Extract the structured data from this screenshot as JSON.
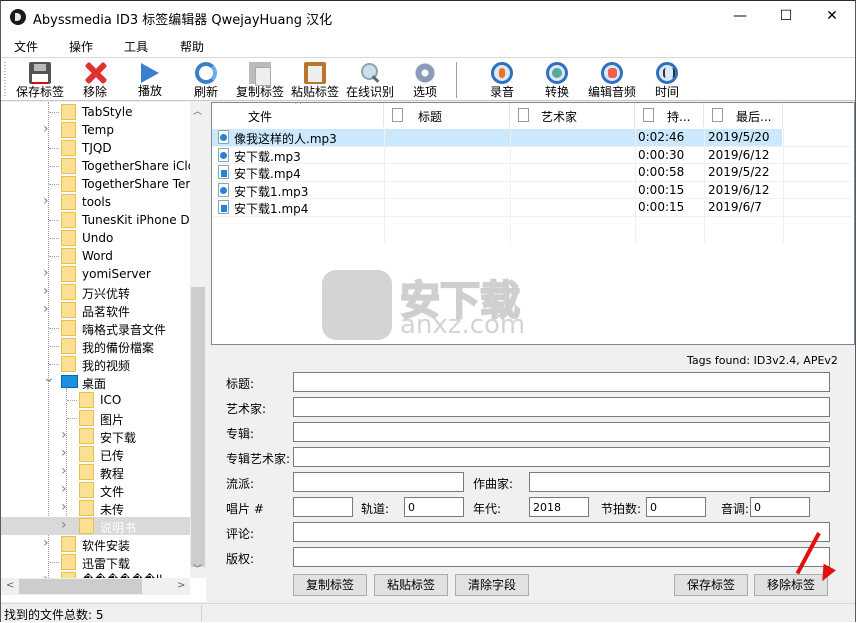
{
  "window": {
    "title": "Abyssmedia ID3 标签编辑器 QwejayHuang 汉化",
    "controls": {
      "minimize": "—",
      "maximize": "☐",
      "close": "✕"
    }
  },
  "menu": [
    "文件",
    "操作",
    "工具",
    "帮助"
  ],
  "toolbar": [
    {
      "label": "保存标签",
      "icon": "save-icon"
    },
    {
      "label": "移除",
      "icon": "remove-icon"
    },
    {
      "label": "播放",
      "icon": "play-icon"
    },
    {
      "label": "刷新",
      "icon": "refresh-icon"
    },
    {
      "label": "复制标签",
      "icon": "copy-icon"
    },
    {
      "label": "粘贴标签",
      "icon": "paste-icon"
    },
    {
      "label": "在线识别",
      "icon": "search-icon"
    },
    {
      "label": "选项",
      "icon": "gear-icon"
    },
    {
      "label": "录音",
      "icon": "microphone-icon"
    },
    {
      "label": "转换",
      "icon": "convert-icon"
    },
    {
      "label": "编辑音频",
      "icon": "audio-edit-icon"
    },
    {
      "label": "时间",
      "icon": "equalizer-icon"
    }
  ],
  "tree": {
    "items": [
      {
        "name": "TabStyle",
        "expandable": false
      },
      {
        "name": "Temp",
        "expandable": true
      },
      {
        "name": "TJQD",
        "expandable": false
      },
      {
        "name": "TogetherShare iCloud I",
        "expandable": false
      },
      {
        "name": "TogetherShare Temp E",
        "expandable": false
      },
      {
        "name": "tools",
        "expandable": true
      },
      {
        "name": "TunesKit iPhone Data R",
        "expandable": false
      },
      {
        "name": "Undo",
        "expandable": false
      },
      {
        "name": "Word",
        "expandable": false
      },
      {
        "name": "yomiServer",
        "expandable": true
      },
      {
        "name": "万兴优转",
        "expandable": true
      },
      {
        "name": "品茗软件",
        "expandable": true
      },
      {
        "name": "嗨格式录音文件",
        "expandable": false
      },
      {
        "name": "我的備份檔案",
        "expandable": false
      },
      {
        "name": "我的视频",
        "expandable": false
      },
      {
        "name": "桌面",
        "expandable": true,
        "expanded": true
      },
      {
        "name": "ICO",
        "expandable": false,
        "child": true
      },
      {
        "name": "图片",
        "expandable": false,
        "child": true
      },
      {
        "name": "安下载",
        "expandable": true,
        "child": true
      },
      {
        "name": "已传",
        "expandable": true,
        "child": true
      },
      {
        "name": "教程",
        "expandable": true,
        "child": true
      },
      {
        "name": "文件",
        "expandable": true,
        "child": true
      },
      {
        "name": "未传",
        "expandable": true,
        "child": true
      },
      {
        "name": "说明书",
        "expandable": true,
        "child": true,
        "selected": true
      },
      {
        "name": "软件安装",
        "expandable": true
      },
      {
        "name": "迅雷下载",
        "expandable": false
      },
      {
        "name": "������ll",
        "expandable": true
      }
    ]
  },
  "filelist": {
    "columns": [
      "文件",
      "标题",
      "艺术家",
      "持...",
      "最后..."
    ],
    "rows": [
      {
        "file": "像我这样的人.mp3",
        "type": "mp3",
        "title": "",
        "artist": "",
        "duration": "0:02:46",
        "modified": "2019/5/20",
        "selected": true
      },
      {
        "file": "安下载.mp3",
        "type": "mp3",
        "title": "",
        "artist": "",
        "duration": "0:00:30",
        "modified": "2019/6/12"
      },
      {
        "file": "安下载.mp4",
        "type": "mp4",
        "title": "",
        "artist": "",
        "duration": "0:00:58",
        "modified": "2019/5/22"
      },
      {
        "file": "安下载1.mp3",
        "type": "mp3",
        "title": "",
        "artist": "",
        "duration": "0:00:15",
        "modified": "2019/6/12"
      },
      {
        "file": "安下载1.mp4",
        "type": "mp4",
        "title": "",
        "artist": "",
        "duration": "0:00:15",
        "modified": "2019/6/7"
      }
    ]
  },
  "watermark": {
    "text": "安下载",
    "url": "anxz.com"
  },
  "tags": {
    "found": "Tags found: ID3v2.4, APEv2",
    "title_label": "标题:",
    "title": "",
    "artist_label": "艺术家:",
    "artist": "",
    "album_label": "专辑:",
    "album": "",
    "album_artist_label": "专辑艺术家:",
    "album_artist": "",
    "genre_label": "流派:",
    "genre": "",
    "composer_label": "作曲家:",
    "composer": "",
    "disc_label": "唱片 #",
    "disc": "",
    "track_label": "轨道:",
    "track": "0",
    "year_label": "年代:",
    "year": "2018",
    "bpm_label": "节拍数:",
    "bpm": "0",
    "key_label": "音调:",
    "key": "0",
    "comment_label": "评论:",
    "comment": "",
    "copyright_label": "版权:",
    "copyright": ""
  },
  "buttons": {
    "copy": "复制标签",
    "paste": "粘贴标签",
    "clear": "清除字段",
    "save": "保存标签",
    "remove": "移除标签"
  },
  "status": {
    "text": "找到的文件总数: 5"
  }
}
